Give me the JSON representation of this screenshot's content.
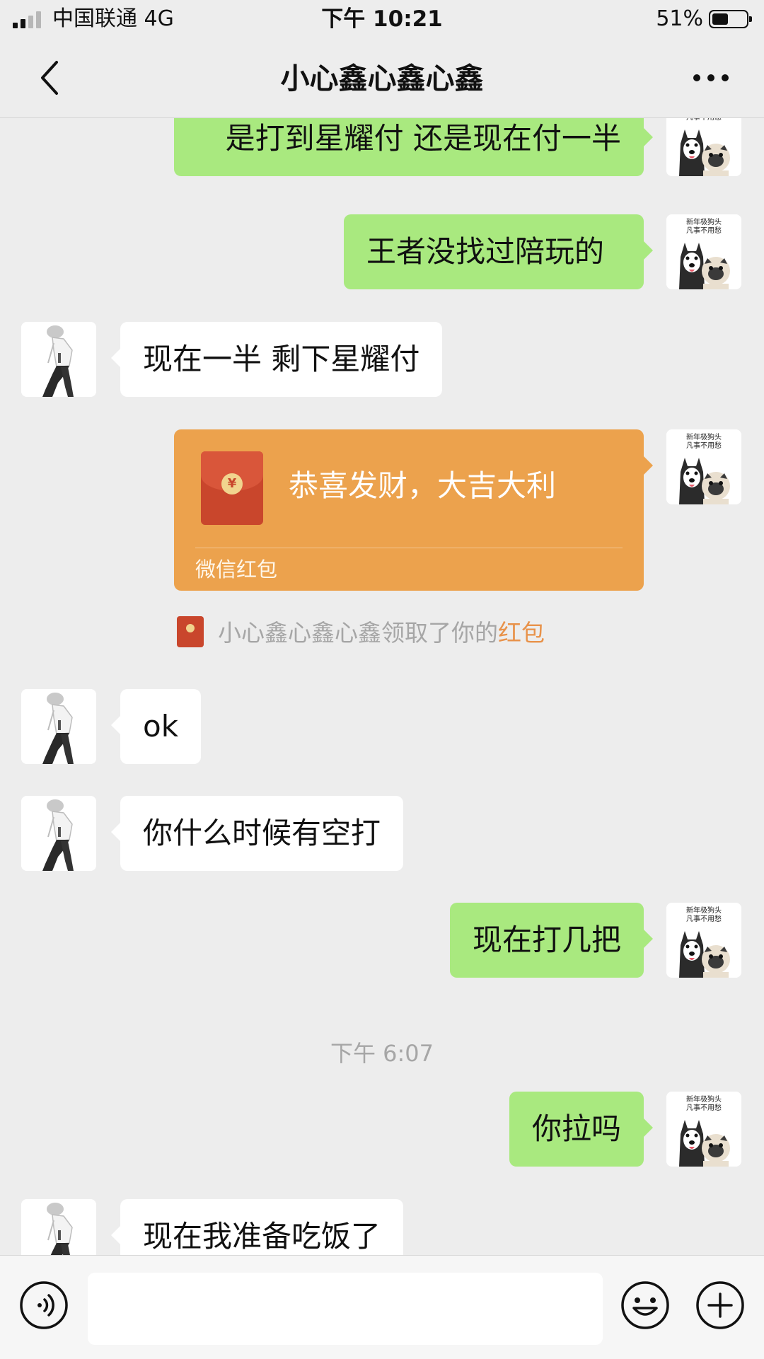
{
  "status_bar": {
    "carrier": "中国联通   4G",
    "time": "下午 10:21",
    "battery_percent": "51%",
    "battery_level": 0.51,
    "signal_bars_active": 2,
    "signal_bars_total": 4
  },
  "nav": {
    "title": "小心鑫心鑫心鑫",
    "back_icon": "chevron-left-icon",
    "more_icon": "ellipsis-icon"
  },
  "messages": [
    {
      "from": "me",
      "text": "是打到星耀付 还是现在付一半"
    },
    {
      "from": "me",
      "text": "王者没找过陪玩的"
    },
    {
      "from": "them",
      "text": "现在一半 剩下星耀付"
    },
    {
      "from": "them",
      "text": "ok"
    },
    {
      "from": "them",
      "text": "你什么时候有空打"
    },
    {
      "from": "me",
      "text": "现在打几把"
    },
    {
      "from": "me",
      "text": "你拉吗"
    },
    {
      "from": "them",
      "text": "现在我准备吃饭了"
    }
  ],
  "red_packet": {
    "message": "恭喜发财，大吉大利",
    "footer": "微信红包"
  },
  "system_message": {
    "prefix": "小心鑫心鑫心鑫领取了你的",
    "link": "红包"
  },
  "timestamp": "下午 6:07",
  "my_avatar_caption": [
    "新年极狗头",
    "凡事不用愁"
  ],
  "input_bar": {
    "placeholder": "",
    "voice_icon": "voice-icon",
    "emoji_icon": "emoji-icon",
    "plus_icon": "plus-icon"
  },
  "colors": {
    "background": "#ededed",
    "my_bubble": "#a9e97f",
    "their_bubble": "#ffffff",
    "red_packet": "#eca24d",
    "link": "#e8924a"
  }
}
